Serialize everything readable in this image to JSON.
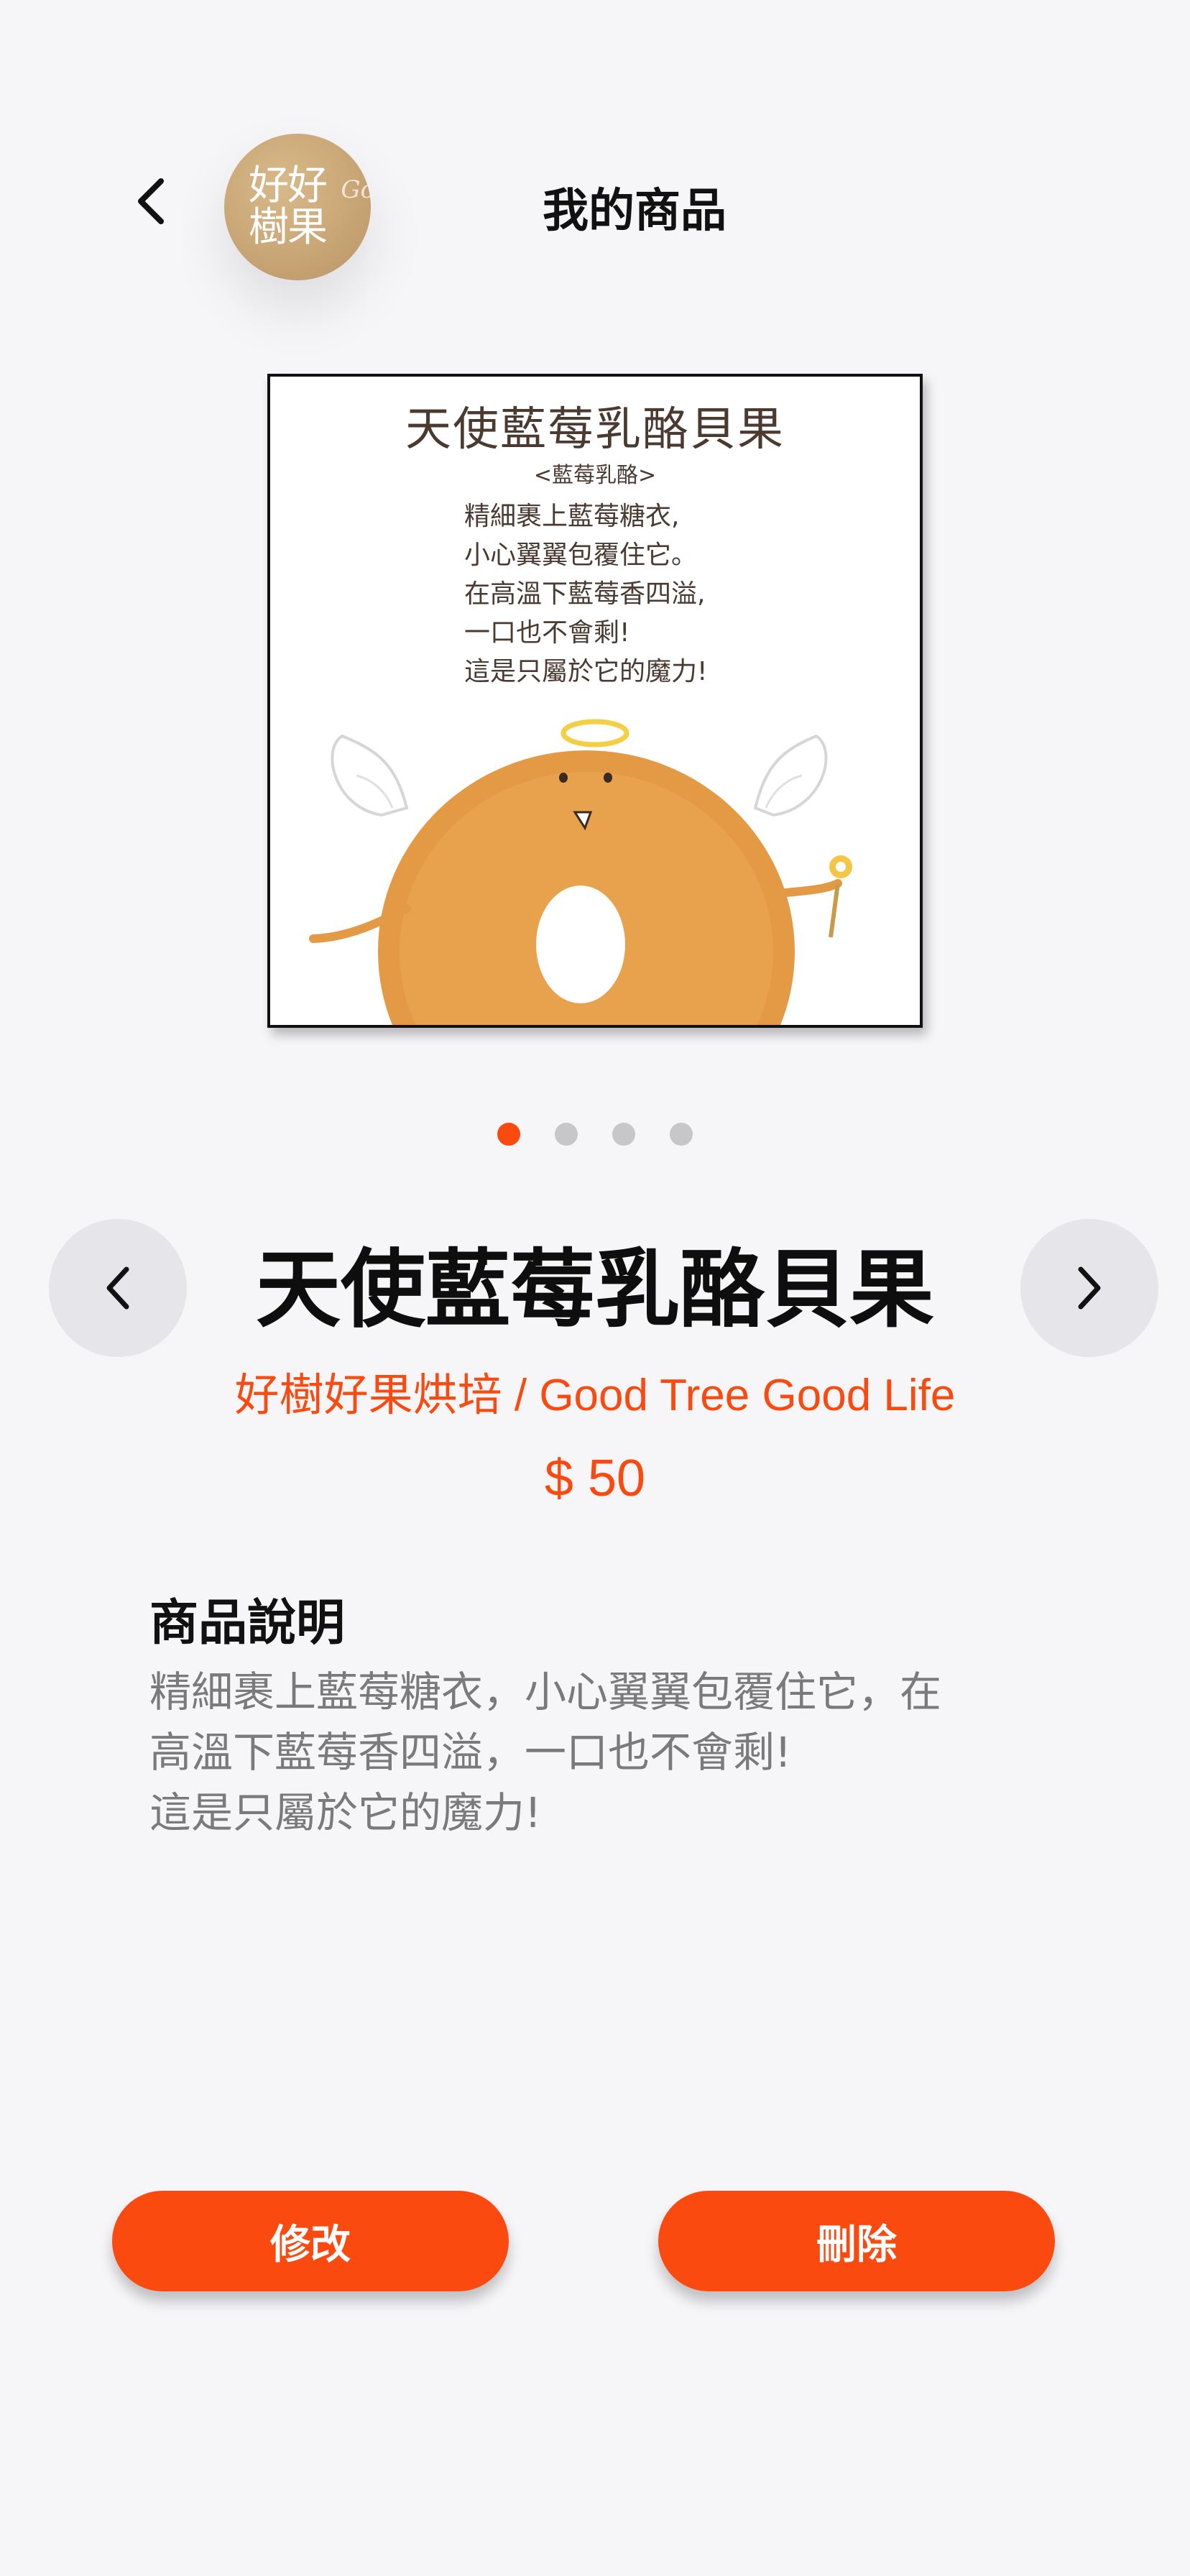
{
  "header": {
    "back_icon": "chevron-left-icon",
    "logo_text": "好好樹果",
    "logo_script": "Go",
    "title": "我的商品"
  },
  "product_image": {
    "title": "天使藍莓乳酪貝果",
    "subtitle": "<藍莓乳酪>",
    "poem": "精細裹上藍莓糖衣,\n小心翼翼包覆住它。\n在高溫下藍莓香四溢,\n一口也不會剩!\n這是只屬於它的魔力!"
  },
  "carousel": {
    "dot_count": 4,
    "active_index": 0
  },
  "product": {
    "name": "天使藍莓乳酪貝果",
    "store": "好樹好果烘培 / Good Tree Good Life",
    "price": "$ 50"
  },
  "description": {
    "heading": "商品說明",
    "body": "精細裹上藍莓糖衣，小心翼翼包覆住它，在\n高溫下藍莓香四溢，一口也不會剩!\n這是只屬於它的魔力!"
  },
  "actions": {
    "edit_label": "修改",
    "delete_label": "刪除"
  },
  "colors": {
    "accent": "#fb4a10",
    "background": "#f6f5f8",
    "nav_circle": "#e6e5e9",
    "text_muted": "#7a7a7d"
  }
}
